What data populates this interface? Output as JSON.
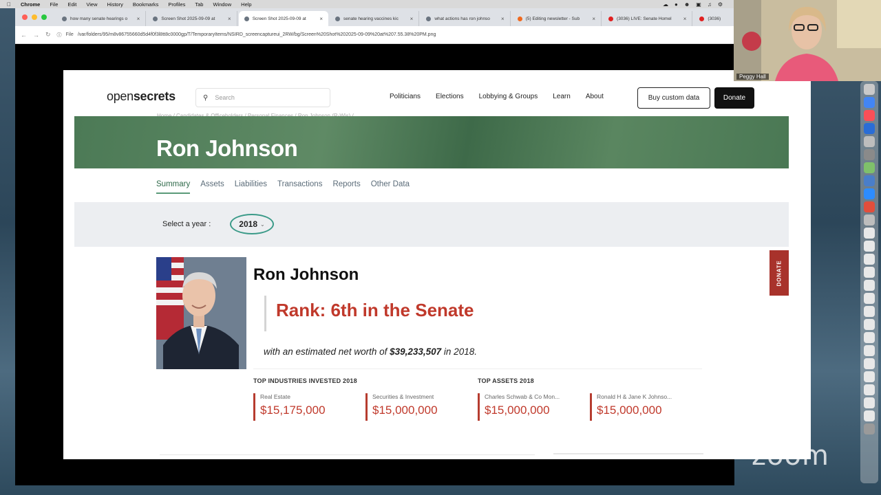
{
  "menubar": {
    "app_name": "Chrome",
    "items": [
      "File",
      "Edit",
      "View",
      "History",
      "Bookmarks",
      "Profiles",
      "Tab",
      "Window",
      "Help"
    ]
  },
  "browser": {
    "tabs": [
      {
        "label": "how many senate hearings o",
        "active": false
      },
      {
        "label": "Screen Shot 2025-09-09 at",
        "active": false
      },
      {
        "label": "Screen Shot 2025-09-09 at",
        "active": true
      },
      {
        "label": "senate hearing vaccines kic",
        "active": false
      },
      {
        "label": "what actions has ron johnso",
        "active": false
      },
      {
        "label": "(5) Editing newsletter - Sub",
        "active": false
      },
      {
        "label": "(3036) LIVE: Senate Homel",
        "active": false
      },
      {
        "label": "(3036)",
        "active": false
      }
    ],
    "url_prefix": "File",
    "url": "/var/folders/95/m8v86755660d5d4f0f3l8tt8c0000gp/T/TemporaryItems/NSIRD_screencaptureui_2RW/bg/Screen%20Shot%202025-09-09%20at%207.55.38%20PM.png"
  },
  "site": {
    "logo_open": "open",
    "logo_secrets": "secrets",
    "search_placeholder": "Search",
    "nav": [
      "Politicians",
      "Elections",
      "Lobbying & Groups",
      "Learn",
      "About"
    ],
    "buy_label": "Buy custom data",
    "donate_label": "Donate",
    "breadcrumb": "Home  /  Candidates & Officeholders  /  Personal Finances  /  Ron Johnson (R-Wis)  /"
  },
  "profile": {
    "banner_title": "Ron Johnson",
    "subnav": [
      "Summary",
      "Assets",
      "Liabilities",
      "Transactions",
      "Reports",
      "Other Data"
    ],
    "year_label": "Select a year :",
    "year_value": "2018",
    "name": "Ron Johnson",
    "rank": "Rank: 6th in the Senate",
    "networth_prefix": "with an estimated net worth of ",
    "networth_value": "$39,233,507",
    "networth_suffix": " in 2018.",
    "industries_heading": "TOP INDUSTRIES INVESTED 2018",
    "assets_heading": "TOP ASSETS 2018",
    "industries": [
      {
        "label": "Real Estate",
        "value": "$15,175,000"
      },
      {
        "label": "Securities & Investment",
        "value": "$15,000,000"
      }
    ],
    "assets": [
      {
        "label": "Charles Schwab & Co Mon...",
        "value": "$15,000,000"
      },
      {
        "label": "Ronald H & Jane K Johnso...",
        "value": "$15,000,000"
      }
    ],
    "side_tab": "DONATE"
  },
  "zoom": {
    "participant_name": "Peggy Hall",
    "watermark": "zoom"
  },
  "colors": {
    "banner_green": "#4c7a56",
    "rank_red": "#c0392b",
    "year_circle": "#3a9a88"
  }
}
